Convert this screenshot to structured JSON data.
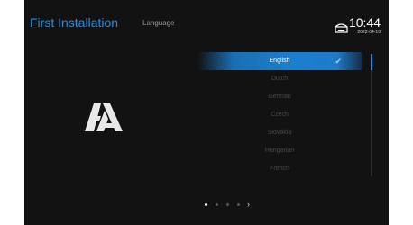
{
  "header": {
    "title": "First Installation",
    "subtitle": "Language",
    "time": "10:44",
    "date": "2022-04-19",
    "status_icon": "network-icon"
  },
  "languages": {
    "items": [
      "English",
      "Dutch",
      "German",
      "Czech",
      "Slovakia",
      "Hungarian",
      "French"
    ],
    "selected": "English"
  },
  "pager": {
    "pages": 4,
    "current": 1,
    "next_symbol": "›"
  },
  "colors": {
    "accent": "#1e8fe8",
    "background": "#121212",
    "inactive_text": "#4a4a4a"
  }
}
